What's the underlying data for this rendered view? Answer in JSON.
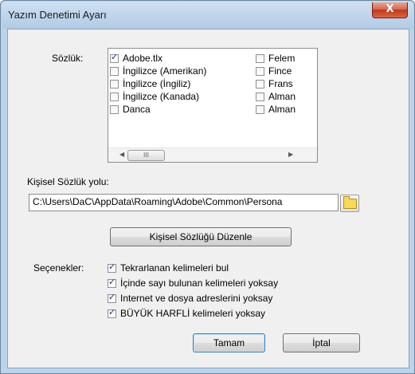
{
  "window": {
    "title": "Yazım Denetimi Ayarı",
    "close_glyph": "X"
  },
  "dictionary": {
    "label": "Sözlük:",
    "items_col1": [
      {
        "label": "Adobe.tlx",
        "checked": true
      },
      {
        "label": "İngilizce (Amerikan)",
        "checked": false
      },
      {
        "label": "İngilizce (İngiliz)",
        "checked": false
      },
      {
        "label": "İngilizce (Kanada)",
        "checked": false
      },
      {
        "label": "Danca",
        "checked": false
      }
    ],
    "items_col2": [
      {
        "label": "Felem",
        "checked": false
      },
      {
        "label": "Fince",
        "checked": false
      },
      {
        "label": "Frans",
        "checked": false
      },
      {
        "label": "Alman",
        "checked": false
      },
      {
        "label": "Alman",
        "checked": false
      }
    ],
    "scroll_left": "◀",
    "scroll_right": "▶",
    "scroll_thumb": "III"
  },
  "personal_path": {
    "label": "Kişisel Sözlük yolu:",
    "value": "C:\\Users\\DaC\\AppData\\Roaming\\Adobe\\Common\\Persona"
  },
  "edit_button_label": "Kişisel Sözlüğü Düzenle",
  "options": {
    "label": "Seçenekler:",
    "items": [
      {
        "label": "Tekrarlanan kelimeleri bul",
        "checked": true
      },
      {
        "label": "İçinde sayı bulunan kelimeleri yoksay",
        "checked": true
      },
      {
        "label": "Internet ve dosya adreslerini yoksay",
        "checked": true
      },
      {
        "label": "BÜYÜK HARFLİ kelimeleri yoksay",
        "checked": true
      }
    ]
  },
  "buttons": {
    "ok": "Tamam",
    "cancel": "İptal"
  },
  "icons": {
    "folder": "folder-icon",
    "checkbox_checked": "checkmark-icon"
  }
}
